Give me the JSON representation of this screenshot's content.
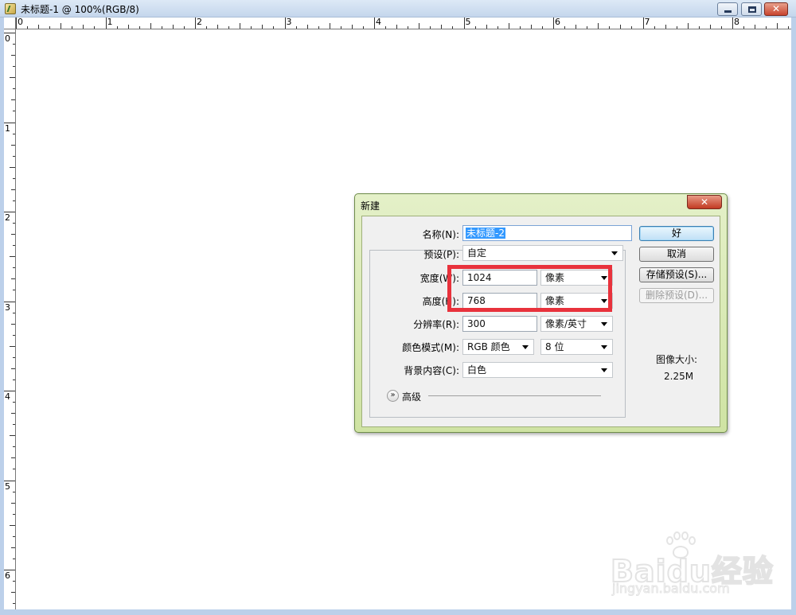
{
  "window": {
    "title": "未标题-1 @ 100%(RGB/8)",
    "close_glyph": "✕"
  },
  "rulers": {
    "top_labels": [
      "0",
      "1",
      "2",
      "3",
      "4",
      "5",
      "6",
      "7",
      "8"
    ],
    "left_labels": [
      "0",
      "1",
      "2",
      "3",
      "4",
      "5",
      "6"
    ]
  },
  "dialog": {
    "title": "新建",
    "close_glyph": "✕",
    "name_label": "名称(N):",
    "name_value": "未标题-2",
    "preset_label": "预设(P):",
    "preset_value": "自定",
    "width_label": "宽度(W):",
    "width_value": "1024",
    "width_unit": "像素",
    "height_label": "高度(H):",
    "height_value": "768",
    "height_unit": "像素",
    "resolution_label": "分辨率(R):",
    "resolution_value": "300",
    "resolution_unit": "像素/英寸",
    "color_mode_label": "颜色模式(M):",
    "color_mode_value": "RGB 颜色",
    "bit_depth_value": "8 位",
    "background_label": "背景内容(C):",
    "background_value": "白色",
    "advanced_label": "高级",
    "ok_button": "好",
    "cancel_button": "取消",
    "save_preset_button": "存储预设(S)...",
    "delete_preset_button": "删除预设(D)...",
    "image_size_label": "图像大小:",
    "image_size_value": "2.25M"
  },
  "watermark": {
    "brand": "Baidu经验",
    "url": "jingyan.baidu.com"
  },
  "colors": {
    "highlight": "#e8323c",
    "dialog_frame": "#cfe3a3",
    "selection": "#3399ff"
  }
}
